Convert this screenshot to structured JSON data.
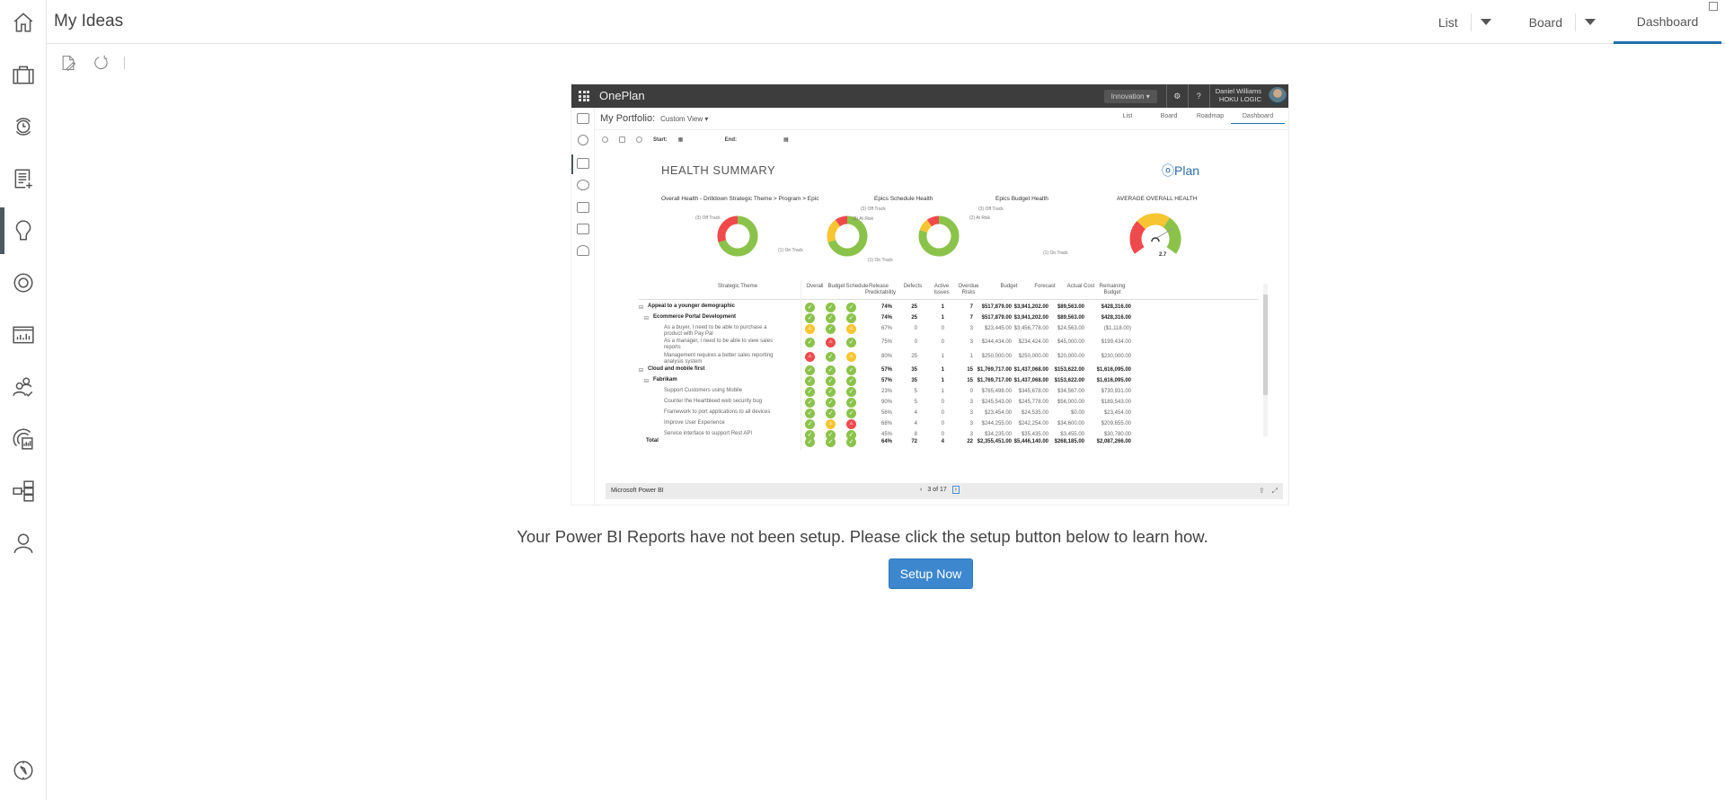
{
  "header": {
    "title": "My Ideas"
  },
  "view_tabs": [
    {
      "label": "List",
      "has_dropdown": true
    },
    {
      "label": "Board",
      "has_dropdown": true
    },
    {
      "label": "Dashboard",
      "active": true
    }
  ],
  "sidebar": {
    "items": [
      {
        "icon": "home-icon"
      },
      {
        "icon": "briefcase-icon"
      },
      {
        "icon": "timesheet-clock-icon"
      },
      {
        "icon": "task-list-add-icon"
      },
      {
        "icon": "lightbulb-icon",
        "active": true
      },
      {
        "icon": "target-icon"
      },
      {
        "icon": "report-chart-icon"
      },
      {
        "icon": "resource-users-icon"
      },
      {
        "icon": "portfolio-report-icon"
      },
      {
        "icon": "org-structure-icon"
      },
      {
        "icon": "user-icon"
      }
    ],
    "footer_icon": "compass-icon"
  },
  "toolbar": {
    "items": [
      "edit-document-icon",
      "refresh-icon"
    ]
  },
  "preview": {
    "app_name": "OnePlan",
    "workspace_select": "Innovation",
    "user_name": "Daniel Williams",
    "user_org": "HOKU LOGIC",
    "subtitle": "My Portfolio:",
    "view": "Custom View",
    "tabs": [
      "List",
      "Board",
      "Roadmap",
      "Dashboard"
    ],
    "start_label": "Start:",
    "end_label": "End:",
    "report_title": "HEALTH SUMMARY",
    "logo_text": "Plan",
    "charts": [
      {
        "title": "Overall Health - Drilldown Strategic Theme > Program > Epic",
        "labels": [
          "(3) Off Track",
          "(1) On Track"
        ],
        "values": [
          3,
          7
        ]
      },
      {
        "title": "Epics Schedule Health",
        "labels": [
          "(3) Off Track",
          "(2) At Risk",
          "(1) On Track"
        ],
        "values": [
          1,
          2,
          7
        ]
      },
      {
        "title": "Epics Budget Health",
        "labels": [
          "(3) Off Track",
          "(2) At Risk",
          "(1) On Track"
        ],
        "values": [
          1,
          1,
          8
        ]
      },
      {
        "title": "AVERAGE OVERALL HEALTH",
        "value": "2.7"
      }
    ],
    "table": {
      "headers": [
        "Strategic Theme",
        "Overall",
        "Budget",
        "Schedule",
        "Release Predictability",
        "Defects",
        "Active Issues",
        "Overdue Risks",
        "Budget",
        "Forecast",
        "Actual Cost",
        "Remaining Budget"
      ],
      "rows": [
        {
          "level": 0,
          "name": "Appeal to a younger demographic",
          "status": [
            "g",
            "g",
            "g"
          ],
          "rp": "74%",
          "def": "25",
          "ai": "1",
          "or": "7",
          "budget": "$517,879.00",
          "forecast": "$3,941,202.00",
          "actual": "$89,563.00",
          "remaining": "$428,316.00"
        },
        {
          "level": 1,
          "name": "Ecommerce Portal Development",
          "status": [
            "g",
            "g",
            "g"
          ],
          "rp": "74%",
          "def": "25",
          "ai": "1",
          "or": "7",
          "budget": "$517,879.00",
          "forecast": "$3,941,202.00",
          "actual": "$89,563.00",
          "remaining": "$428,316.00"
        },
        {
          "level": 2,
          "name": "As a buyer, I need to be able to purchase a product with Pay Pal",
          "status": [
            "y",
            "g",
            "y"
          ],
          "rp": "67%",
          "def": "0",
          "ai": "0",
          "or": "3",
          "budget": "$23,445.00",
          "forecast": "$3,456,778.00",
          "actual": "$24,563.00",
          "remaining": "($1,118.00)"
        },
        {
          "level": 2,
          "name": "As a manager, I need to be able to view sales reports",
          "status": [
            "g",
            "r",
            "g"
          ],
          "rp": "75%",
          "def": "0",
          "ai": "0",
          "or": "3",
          "budget": "$244,434.00",
          "forecast": "$234,424.00",
          "actual": "$45,000.00",
          "remaining": "$199,434.00"
        },
        {
          "level": 2,
          "name": "Management requires a better sales reporting analysis system",
          "status": [
            "r",
            "g",
            "y"
          ],
          "rp": "80%",
          "def": "25",
          "ai": "1",
          "or": "1",
          "budget": "$250,000.00",
          "forecast": "$250,000.00",
          "actual": "$20,000.00",
          "remaining": "$230,000.00"
        },
        {
          "level": 0,
          "name": "Cloud and mobile first",
          "status": [
            "g",
            "g",
            "g"
          ],
          "rp": "57%",
          "def": "35",
          "ai": "1",
          "or": "15",
          "budget": "$1,769,717.00",
          "forecast": "$1,437,068.00",
          "actual": "$153,622.00",
          "remaining": "$1,616,095.00"
        },
        {
          "level": 1,
          "name": "Fabrikam",
          "status": [
            "g",
            "g",
            "g"
          ],
          "rp": "57%",
          "def": "35",
          "ai": "1",
          "or": "15",
          "budget": "$1,769,717.00",
          "forecast": "$1,437,068.00",
          "actual": "$153,622.00",
          "remaining": "$1,616,095.00"
        },
        {
          "level": 2,
          "name": "Support Customers using Mobile",
          "status": [
            "g",
            "g",
            "g"
          ],
          "rp": "23%",
          "def": "5",
          "ai": "1",
          "or": "0",
          "budget": "$765,498.00",
          "forecast": "$345,678.00",
          "actual": "$34,567.00",
          "remaining": "$730,931.00"
        },
        {
          "level": 2,
          "name": "Counter the Heartbleed web security bug",
          "status": [
            "g",
            "g",
            "g"
          ],
          "rp": "90%",
          "def": "5",
          "ai": "0",
          "or": "3",
          "budget": "$245,543.00",
          "forecast": "$245,778.00",
          "actual": "$56,000.00",
          "remaining": "$189,543.00"
        },
        {
          "level": 2,
          "name": "Framework to port applications to all devices",
          "status": [
            "g",
            "g",
            "g"
          ],
          "rp": "56%",
          "def": "4",
          "ai": "0",
          "or": "3",
          "budget": "$23,454.00",
          "forecast": "$24,535.00",
          "actual": "$0.00",
          "remaining": "$23,454.00"
        },
        {
          "level": 2,
          "name": "Improve User Experience",
          "status": [
            "g",
            "y",
            "r"
          ],
          "rp": "68%",
          "def": "4",
          "ai": "0",
          "or": "3",
          "budget": "$244,255.00",
          "forecast": "$242,254.00",
          "actual": "$34,600.00",
          "remaining": "$209,655.00"
        },
        {
          "level": 2,
          "name": "Service interface to support Rest API",
          "status": [
            "g",
            "g",
            "g"
          ],
          "rp": "45%",
          "def": "8",
          "ai": "0",
          "or": "3",
          "budget": "$34,235.00",
          "forecast": "$35,435.00",
          "actual": "$3,455.00",
          "remaining": "$30,780.00"
        }
      ],
      "total": {
        "name": "Total",
        "status": [
          "g",
          "g",
          "g"
        ],
        "rp": "64%",
        "def": "72",
        "ai": "4",
        "or": "22",
        "budget": "$2,355,451.00",
        "forecast": "$5,446,140.00",
        "actual": "$268,185.00",
        "remaining": "$2,087,266.00"
      }
    },
    "footer": {
      "label": "Microsoft Power BI",
      "page": "3 of 17"
    }
  },
  "message": "Your Power BI Reports have not been setup. Please click the setup button below to learn how.",
  "setup_button": "Setup Now",
  "colors": {
    "accent": "#1f6fa8",
    "button": "#3d87cf",
    "green": "#8bc34a",
    "yellow": "#f7c531",
    "red": "#f0494b"
  }
}
